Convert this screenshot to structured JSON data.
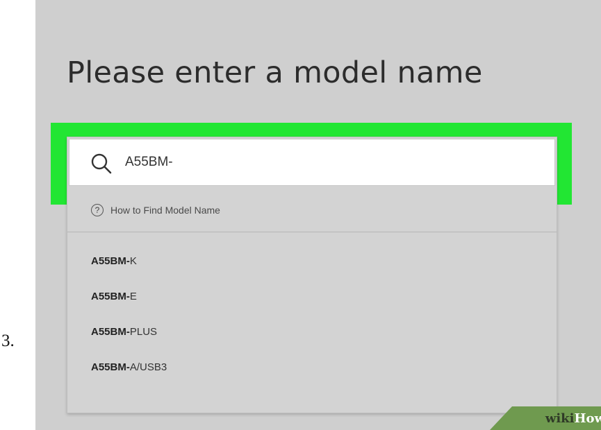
{
  "step_number": "3.",
  "page": {
    "title": "Please enter a model name"
  },
  "search": {
    "value": "A55BM-",
    "icon": "search-icon"
  },
  "help_link": {
    "icon": "question-circle-icon",
    "label": "How to Find Model Name"
  },
  "suggestions": [
    {
      "match": "A55BM-",
      "rest": "K"
    },
    {
      "match": "A55BM-",
      "rest": "E"
    },
    {
      "match": "A55BM-",
      "rest": "PLUS"
    },
    {
      "match": "A55BM-",
      "rest": "A/USB3"
    }
  ],
  "watermark": {
    "wiki": "wiki",
    "how": "How"
  },
  "colors": {
    "highlight": "#22e633",
    "background": "#cfcfcf",
    "watermark_bg": "#6f9a4f"
  }
}
